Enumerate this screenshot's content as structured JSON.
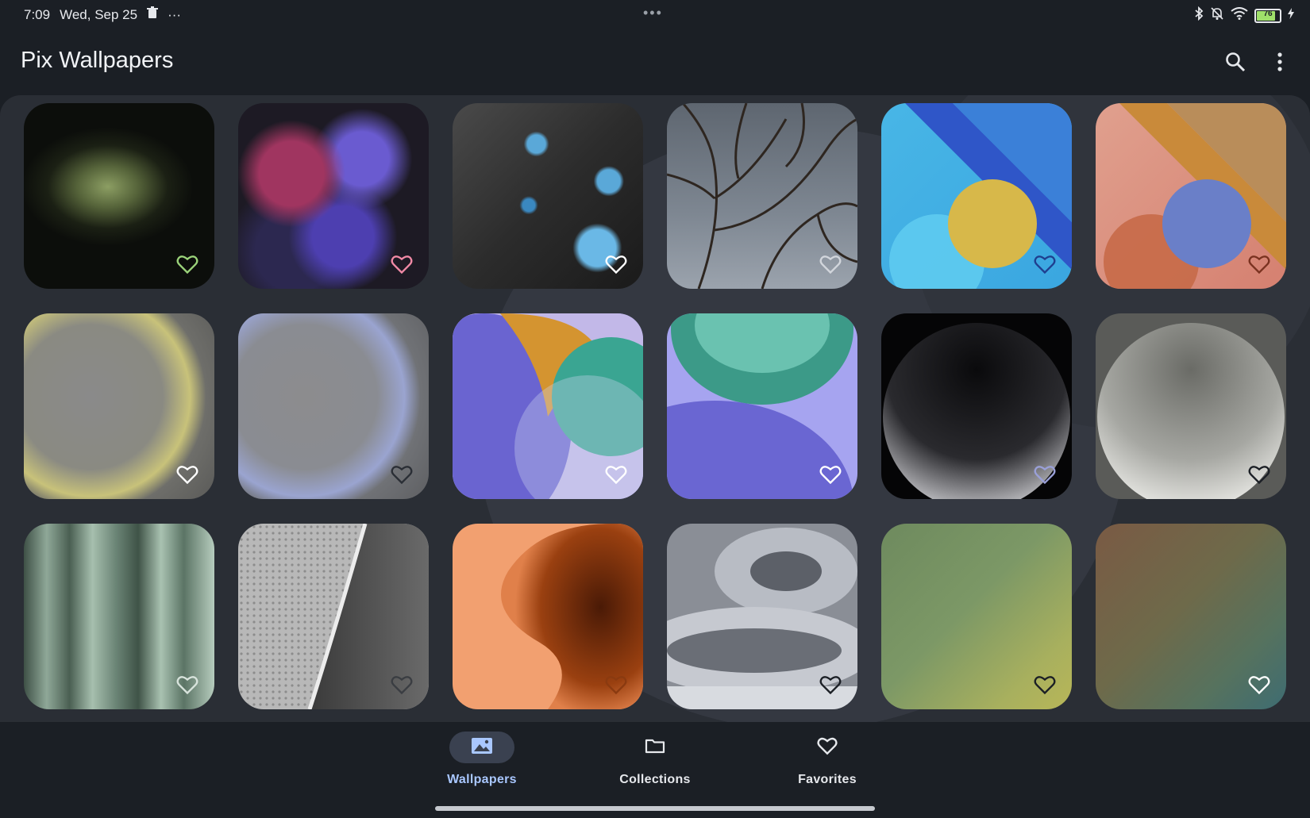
{
  "status_bar": {
    "time": "7:09",
    "date": "Wed, Sep 25",
    "more": "···",
    "center_dots": "•••",
    "battery_level": "76"
  },
  "app_bar": {
    "title": "Pix Wallpapers",
    "search_icon": "search-icon",
    "more_icon": "more-vert-icon"
  },
  "wallpapers": [
    {
      "name": "green-dust-space",
      "heart_color": "#9bd37a"
    },
    {
      "name": "lilac-flowers",
      "heart_color": "#f18aa6"
    },
    {
      "name": "blue-blossoms-dark",
      "heart_color": "#ffffff"
    },
    {
      "name": "bare-tree-branches",
      "heart_color": "#d2d6dc"
    },
    {
      "name": "blue-geometric-sun",
      "heart_color": "#1f3f8f"
    },
    {
      "name": "coral-geometric-sun",
      "heart_color": "#7a3220"
    },
    {
      "name": "yellow-glass-sphere",
      "heart_color": "#ffffff"
    },
    {
      "name": "blue-glass-sphere",
      "heart_color": "#2a2e35"
    },
    {
      "name": "teal-sphere-orange-fur",
      "heart_color": "#ffffff"
    },
    {
      "name": "teal-sphere-purple",
      "heart_color": "#ffffff"
    },
    {
      "name": "dark-black-sphere",
      "heart_color": "#9aa0d8"
    },
    {
      "name": "silver-white-sphere",
      "heart_color": "#1b1f25"
    },
    {
      "name": "green-pillars",
      "heart_color": "#d8e3dc"
    },
    {
      "name": "perforated-grey-curve",
      "heart_color": "#3a3d42"
    },
    {
      "name": "orange-rust-swirl",
      "heart_color": "#8a3a10"
    },
    {
      "name": "grey-clay-swirl",
      "heart_color": "#1b1f25"
    },
    {
      "name": "olive-gradient",
      "heart_color": "#1b1f25"
    },
    {
      "name": "rust-teal-gradient",
      "heart_color": "#ffffff"
    }
  ],
  "bottom_nav": {
    "items": [
      {
        "label": "Wallpapers",
        "icon": "image-icon",
        "active": true
      },
      {
        "label": "Collections",
        "icon": "folder-icon",
        "active": false
      },
      {
        "label": "Favorites",
        "icon": "heart-icon",
        "active": false
      }
    ]
  },
  "colors": {
    "background": "#1b1f25",
    "panel": "#2a2e35",
    "active_accent": "#a9c7ff",
    "active_pill": "#3a4150"
  }
}
